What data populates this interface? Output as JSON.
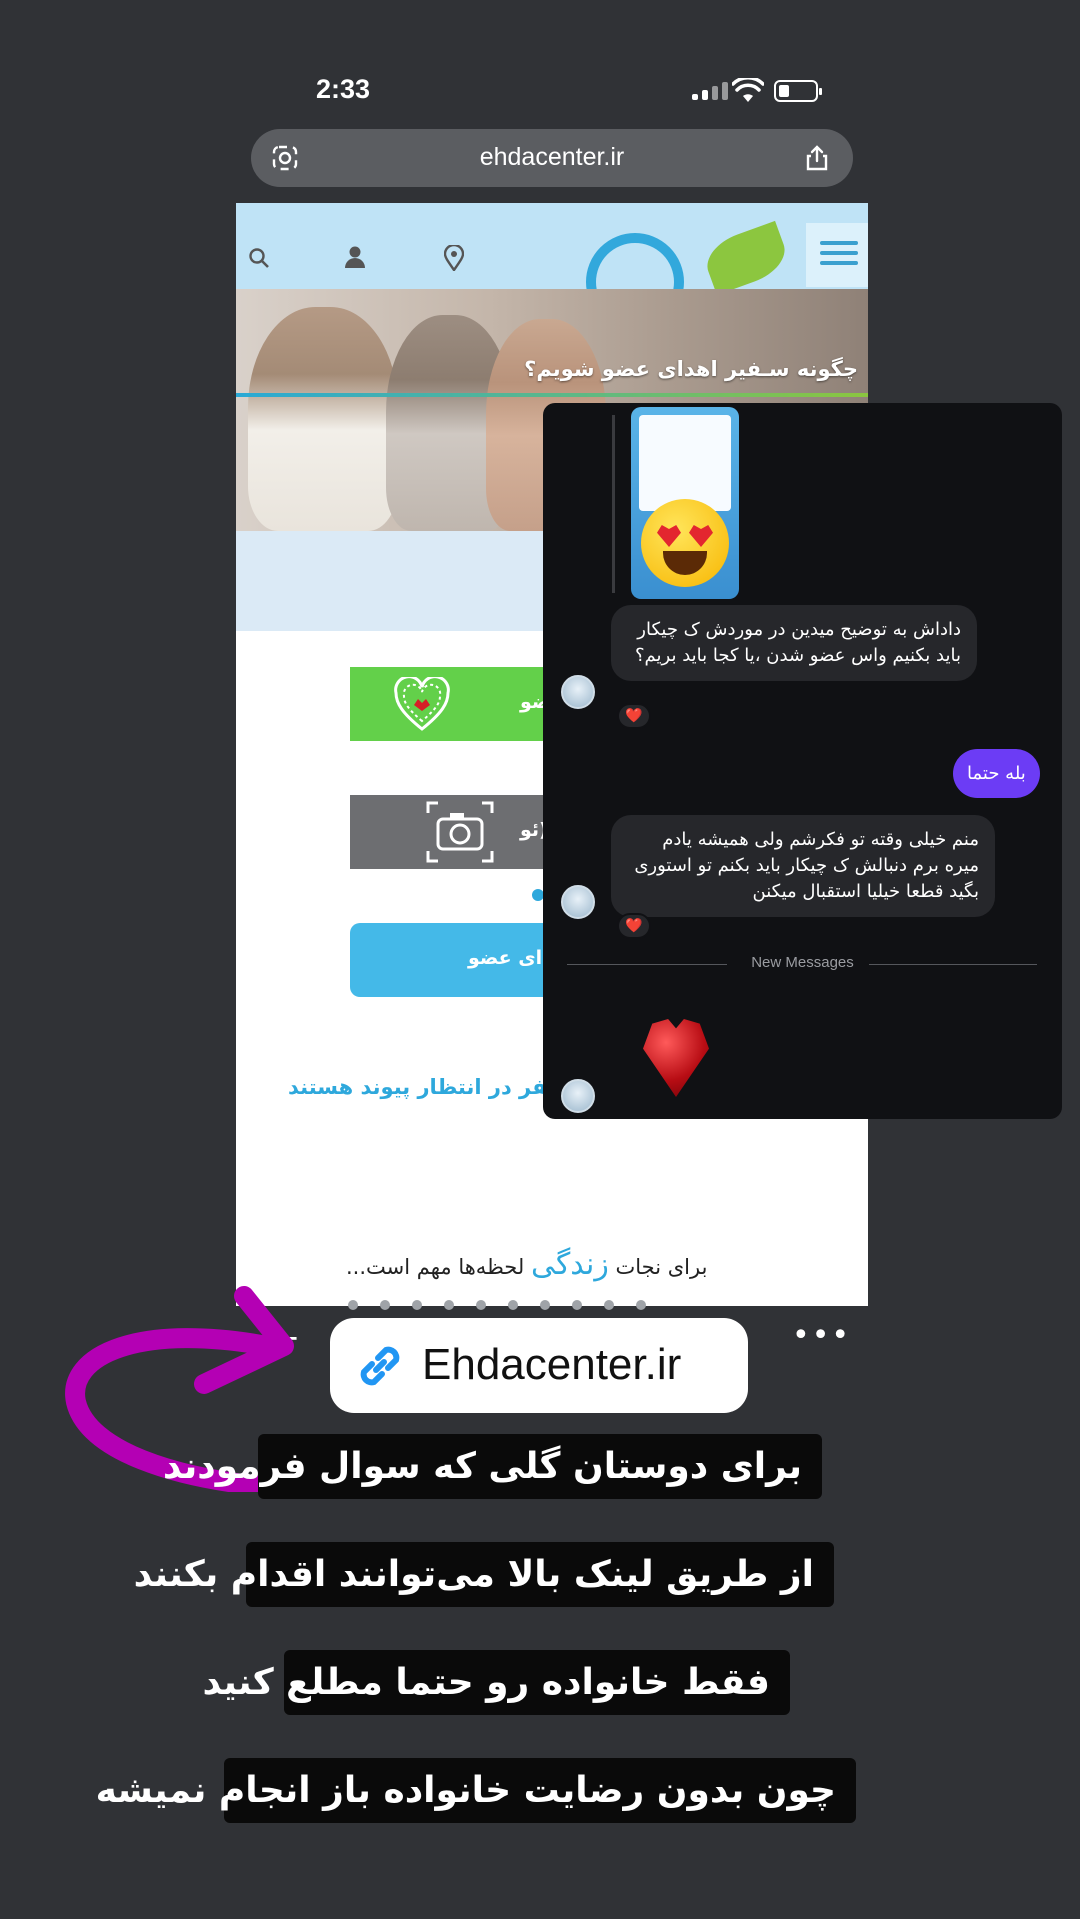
{
  "status_bar": {
    "time": "2:33"
  },
  "browser": {
    "url": "ehdacenter.ir"
  },
  "website": {
    "hero_title": "چگونه سـفیر اهدای عضو شویم؟",
    "button1_label": "عضو",
    "button2_label": "(ئو",
    "button3_label": "دای عضو",
    "waiting_text": "سفر در انتظار پیوند هستند",
    "life_prefix": "برای نجات",
    "life_word": "زندگی",
    "life_suffix": "لحظه‌ها مهم است..."
  },
  "chat": {
    "message1": "داداش به توضیح میدین در موردش ک چیکار باید بکنیم واس عضو شدن ،یا کجا باید بریم؟",
    "reply": "بله حتما",
    "message2": "منم خیلی وقته تو فکرشم ولی همیشه یادم میره برم دنبالش ک چیکار باید بکنم تو استوری بگید قطعا خیلیا استقبال میکنن",
    "reaction": "❤️",
    "new_messages_label": "New Messages"
  },
  "link_sticker": {
    "label": "Ehdacenter.ir",
    "icon": "link-icon"
  },
  "captions": [
    "برای دوستان گلی که سوال فرمودند",
    "از طریق لینک بالا می‌توانند اقدام بکنند",
    "فقط خانواده رو حتما مطلع کنید",
    "چون بدون رضایت خانواده باز انجام نمیشه"
  ],
  "colors": {
    "background": "#303236",
    "accent_purple": "#6c3cf5",
    "annotation_magenta": "#b400b4",
    "site_blue": "#2ea8dc",
    "site_green": "#63d04a"
  }
}
